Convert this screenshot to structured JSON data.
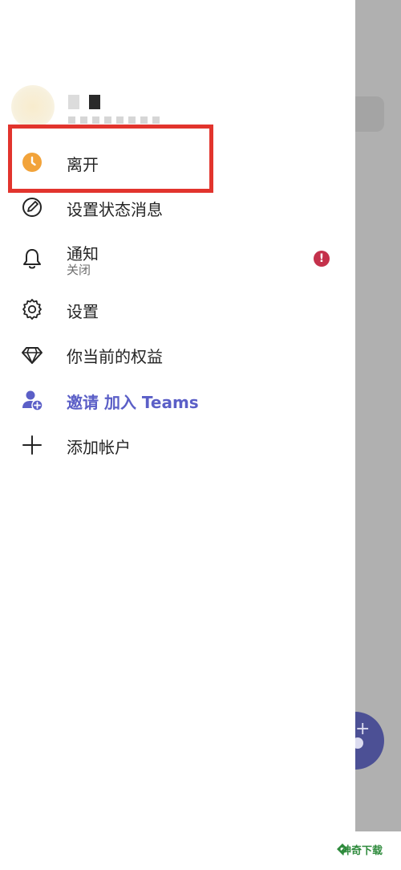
{
  "profile": {
    "avatar_color": "#f8eccd"
  },
  "menu": {
    "away": {
      "label": "离开",
      "status_color": "#f2a33a",
      "icon": "clock-icon"
    },
    "set_status": {
      "label": "设置状态消息",
      "icon": "pen-circle-icon"
    },
    "notifications": {
      "label": "通知",
      "sub": "关闭",
      "icon": "bell-icon",
      "badge": "!"
    },
    "settings": {
      "label": "设置",
      "icon": "gear-icon"
    },
    "benefits": {
      "label": "你当前的权益",
      "icon": "diamond-icon"
    },
    "invite": {
      "label": "邀请 加入 Teams",
      "icon": "add-person-icon"
    },
    "add_account": {
      "label": "添加帐户",
      "icon": "plus-icon"
    }
  },
  "watermark": {
    "text": "神奇下载"
  },
  "colors": {
    "accent": "#5b5fc7",
    "highlight": "#e2342d",
    "badge": "#c4314b",
    "backdrop": "#b0b0b0"
  }
}
